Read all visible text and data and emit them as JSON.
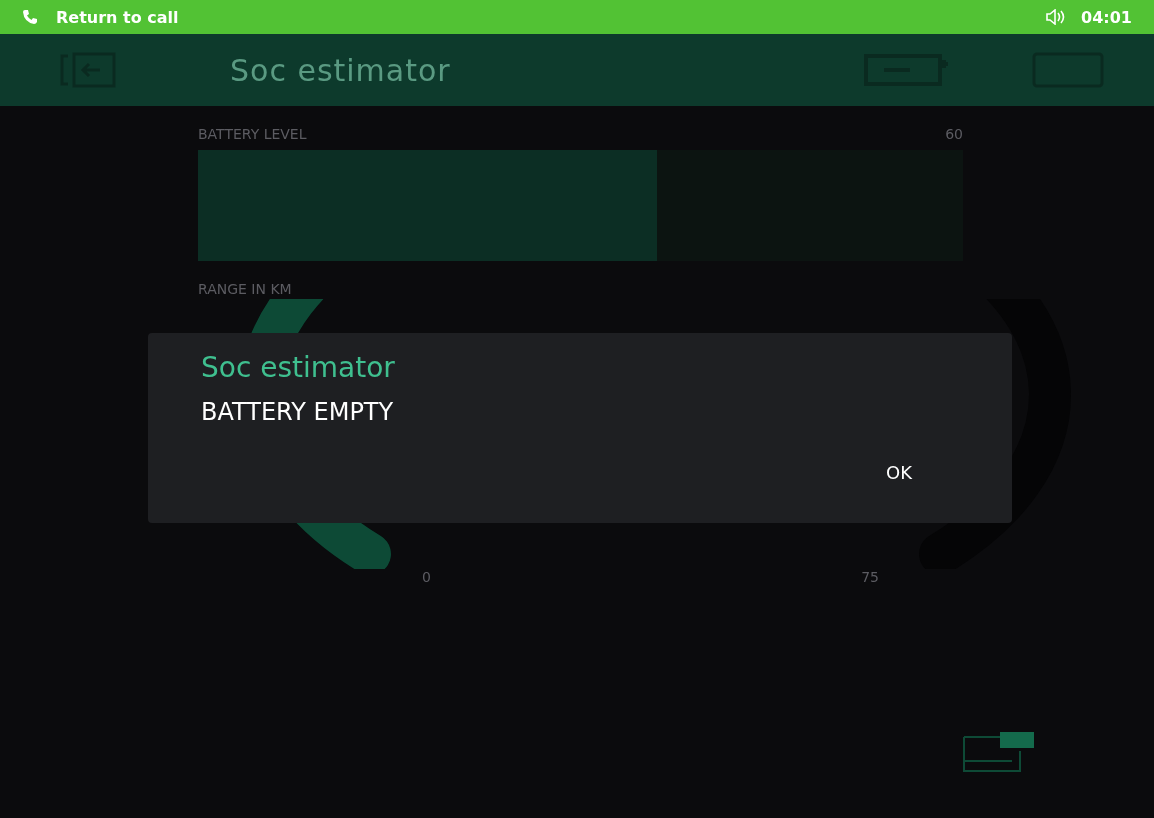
{
  "status_bar": {
    "call_label": "Return to call",
    "time": "04:01"
  },
  "app_bar": {
    "title": "Soc estimator"
  },
  "battery_level": {
    "label": "BATTERY LEVEL",
    "reading": "60",
    "level": 0.6
  },
  "range": {
    "label": "RANGE IN KM",
    "min_label": "0",
    "max_label": "75"
  },
  "dialog": {
    "title": "Soc estimator",
    "message": "BATTERY EMPTY",
    "button": "OK"
  }
}
